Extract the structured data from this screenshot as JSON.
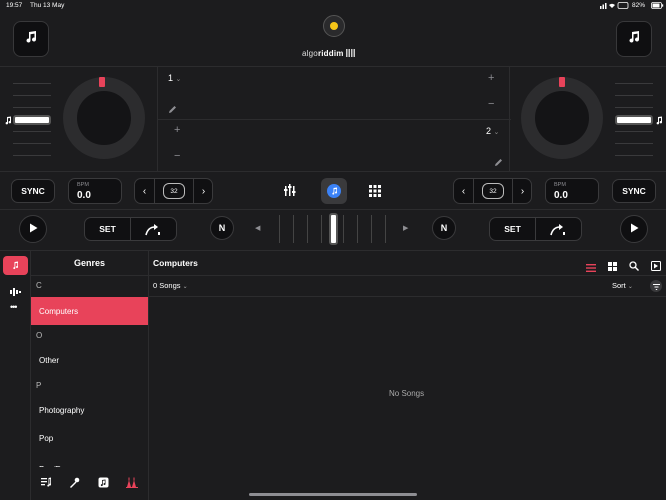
{
  "status": {
    "time": "19:57",
    "date": "Thu 13 May",
    "battery": "82%"
  },
  "brand": {
    "prefix": "algo",
    "name": "riddim"
  },
  "colors": {
    "accent": "#e8435a",
    "blue": "#3b82f6",
    "yellow": "#f5c518"
  },
  "decks": {
    "left": {
      "number": "1",
      "sync": "SYNC",
      "bpm_label": "BPM",
      "bpm": "0.0",
      "loop": "32",
      "set": "SET"
    },
    "right": {
      "number": "2",
      "sync": "SYNC",
      "bpm_label": "BPM",
      "bpm": "0.0",
      "loop": "32",
      "set": "SET"
    }
  },
  "mixer": {
    "plus": "+",
    "minus": "−"
  },
  "library": {
    "sidebar_title": "Genres",
    "main_title": "Computers",
    "song_count": "0 Songs",
    "sort_label": "Sort",
    "empty_text": "No Songs",
    "sections": [
      {
        "letter": "C",
        "items": [
          "Computers"
        ]
      },
      {
        "letter": "O",
        "items": [
          "Other"
        ]
      },
      {
        "letter": "P",
        "items": [
          "Photography",
          "Pop",
          "Pop/Dance"
        ]
      }
    ],
    "selected": "Computers"
  },
  "icons": [
    "music-note-icon",
    "pencil-icon",
    "sliders-icon",
    "grid-icon",
    "play-icon",
    "neural-mix-icon",
    "loop-icon",
    "list-icon",
    "search-icon",
    "sort-filter-icon"
  ]
}
